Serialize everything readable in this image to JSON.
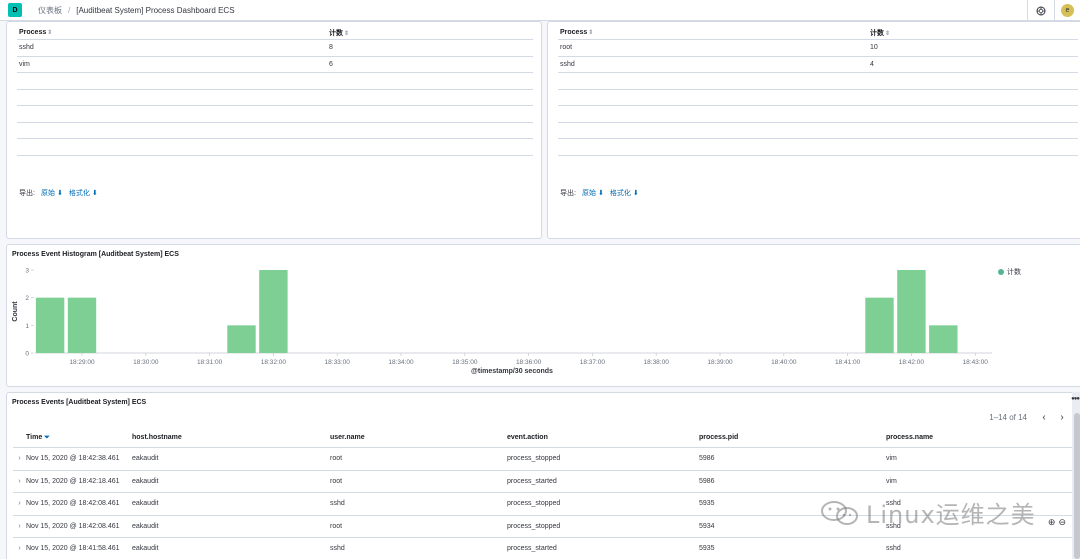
{
  "header": {
    "logo_text": "D",
    "breadcrumb_root": "仪表板",
    "breadcrumb_current": "[Auditbeat System] Process Dashboard ECS",
    "avatar_letter": "e"
  },
  "panel_left": {
    "col_process": "Process",
    "col_count": "计数",
    "rows": [
      {
        "process": "sshd",
        "count": "8"
      },
      {
        "process": "vim",
        "count": "6"
      }
    ],
    "export_label": "导出:",
    "export_raw": "原始",
    "export_formatted": "格式化"
  },
  "panel_right": {
    "col_process": "Process",
    "col_count": "计数",
    "rows": [
      {
        "process": "root",
        "count": "10"
      },
      {
        "process": "sshd",
        "count": "4"
      }
    ],
    "export_label": "导出:",
    "export_raw": "原始",
    "export_formatted": "格式化"
  },
  "histogram": {
    "title": "Process Event Histogram [Auditbeat System] ECS",
    "legend": "计数"
  },
  "chart_data": {
    "type": "bar",
    "title": "Process Event Histogram [Auditbeat System] ECS",
    "xlabel": "@timestamp/30 seconds",
    "ylabel": "Count",
    "ylim": [
      0,
      3
    ],
    "yticks": [
      "0",
      "1",
      "2",
      "3"
    ],
    "xticks": [
      "18:29:00",
      "18:30:00",
      "18:31:00",
      "18:32:00",
      "18:33:00",
      "18:34:00",
      "18:35:00",
      "18:36:00",
      "18:37:00",
      "18:38:00",
      "18:39:00",
      "18:40:00",
      "18:41:00",
      "18:42:00",
      "18:43:00"
    ],
    "series": [
      {
        "name": "计数",
        "color": "#54b399",
        "points": [
          {
            "t": "18:28:30",
            "value": 2
          },
          {
            "t": "18:29:00",
            "value": 2
          },
          {
            "t": "18:31:30",
            "value": 1
          },
          {
            "t": "18:32:00",
            "value": 3
          },
          {
            "t": "18:41:30",
            "value": 2
          },
          {
            "t": "18:42:00",
            "value": 3
          },
          {
            "t": "18:42:30",
            "value": 1
          }
        ]
      }
    ],
    "grid": false,
    "legend_position": "top-right"
  },
  "events": {
    "title": "Process Events [Auditbeat System] ECS",
    "pager_text": "1–14 of 14",
    "columns": [
      "Time",
      "host.hostname",
      "user.name",
      "event.action",
      "process.pid",
      "process.name"
    ],
    "rows": [
      [
        "Nov 15, 2020 @ 18:42:38.461",
        "eakaudit",
        "root",
        "process_stopped",
        "5986",
        "vim"
      ],
      [
        "Nov 15, 2020 @ 18:42:18.461",
        "eakaudit",
        "root",
        "process_started",
        "5986",
        "vim"
      ],
      [
        "Nov 15, 2020 @ 18:42:08.461",
        "eakaudit",
        "sshd",
        "process_stopped",
        "5935",
        "sshd"
      ],
      [
        "Nov 15, 2020 @ 18:42:08.461",
        "eakaudit",
        "root",
        "process_stopped",
        "5934",
        "sshd"
      ],
      [
        "Nov 15, 2020 @ 18:41:58.461",
        "eakaudit",
        "sshd",
        "process_started",
        "5935",
        "sshd"
      ]
    ]
  },
  "watermark": "Linux运维之美",
  "colors": {
    "accent": "#006bb4",
    "bar": "#54b399",
    "logo": "#00bfb3"
  }
}
